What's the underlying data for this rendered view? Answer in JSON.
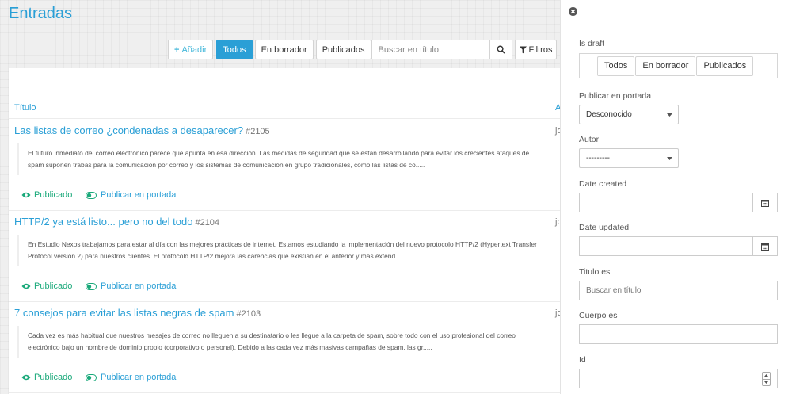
{
  "page": {
    "title": "Entradas"
  },
  "toolbar": {
    "add_label": "Añadir",
    "draft_filters": [
      "Todos",
      "En borrador",
      "Publicados"
    ],
    "active_filter": "Todos",
    "search_placeholder": "Buscar en título",
    "filters_label": "Filtros"
  },
  "table": {
    "headers": {
      "title": "Título",
      "author": "A"
    },
    "rows": [
      {
        "title": "Las listas de correo ¿condenadas a desaparecer?",
        "id": "#2105",
        "author": "jo",
        "excerpt": "El futuro inmediato del correo electrónico parece que apunta en esa dirección. Las medidas de seguridad que se están desarrollando para evitar los crecientes ataques de spam suponen trabas para la comunicación por correo y los sistemas de comunicación en grupo tradicionales, como las listas de co.....",
        "status": "Publicado",
        "portada": "Publicar en portada"
      },
      {
        "title": "HTTP/2 ya está listo... pero no del todo",
        "id": "#2104",
        "author": "jo",
        "excerpt": "En Estudio Nexos trabajamos para estar al día con las mejores prácticas de internet. Estamos estudiando la implementación del nuevo protocolo HTTP/2 (Hypertext Transfer Protocol versión 2) para nuestros clientes. El protocolo HTTP/2 mejora las carencias que existían en el anterior y más extend.....",
        "status": "Publicado",
        "portada": "Publicar en portada"
      },
      {
        "title": "7 consejos para evitar las listas negras de spam",
        "id": "#2103",
        "author": "jo",
        "excerpt": "Cada vez es más habitual que nuestros mesajes de correo no lleguen a su destinatario o les llegue a la carpeta de spam, sobre todo con el uso profesional del correo electrónico bajo un nombre de dominio propio (corporativo o personal). Debido a las cada vez más masivas campañas de spam, las gr.....",
        "status": "Publicado",
        "portada": "Publicar en portada"
      }
    ]
  },
  "filters": {
    "is_draft": {
      "label": "Is draft",
      "options": [
        "Todos",
        "En borrador",
        "Publicados"
      ]
    },
    "publicar_portada": {
      "label": "Publicar en portada",
      "value": "Desconocido"
    },
    "autor": {
      "label": "Autor",
      "value": "---------"
    },
    "date_created": {
      "label": "Date created",
      "value": ""
    },
    "date_updated": {
      "label": "Date updated",
      "value": ""
    },
    "titulo": {
      "label": "Titulo es",
      "placeholder": "Buscar en título"
    },
    "cuerpo": {
      "label": "Cuerpo es",
      "value": ""
    },
    "id": {
      "label": "Id",
      "value": ""
    }
  },
  "colors": {
    "accent": "#2a9fd6",
    "published": "#1aa97a"
  },
  "icons": [
    "plus-icon",
    "search-icon",
    "filter-icon",
    "eye-icon",
    "toggle-icon",
    "close-icon",
    "calendar-icon",
    "caret-down-icon",
    "spinner-icon"
  ]
}
